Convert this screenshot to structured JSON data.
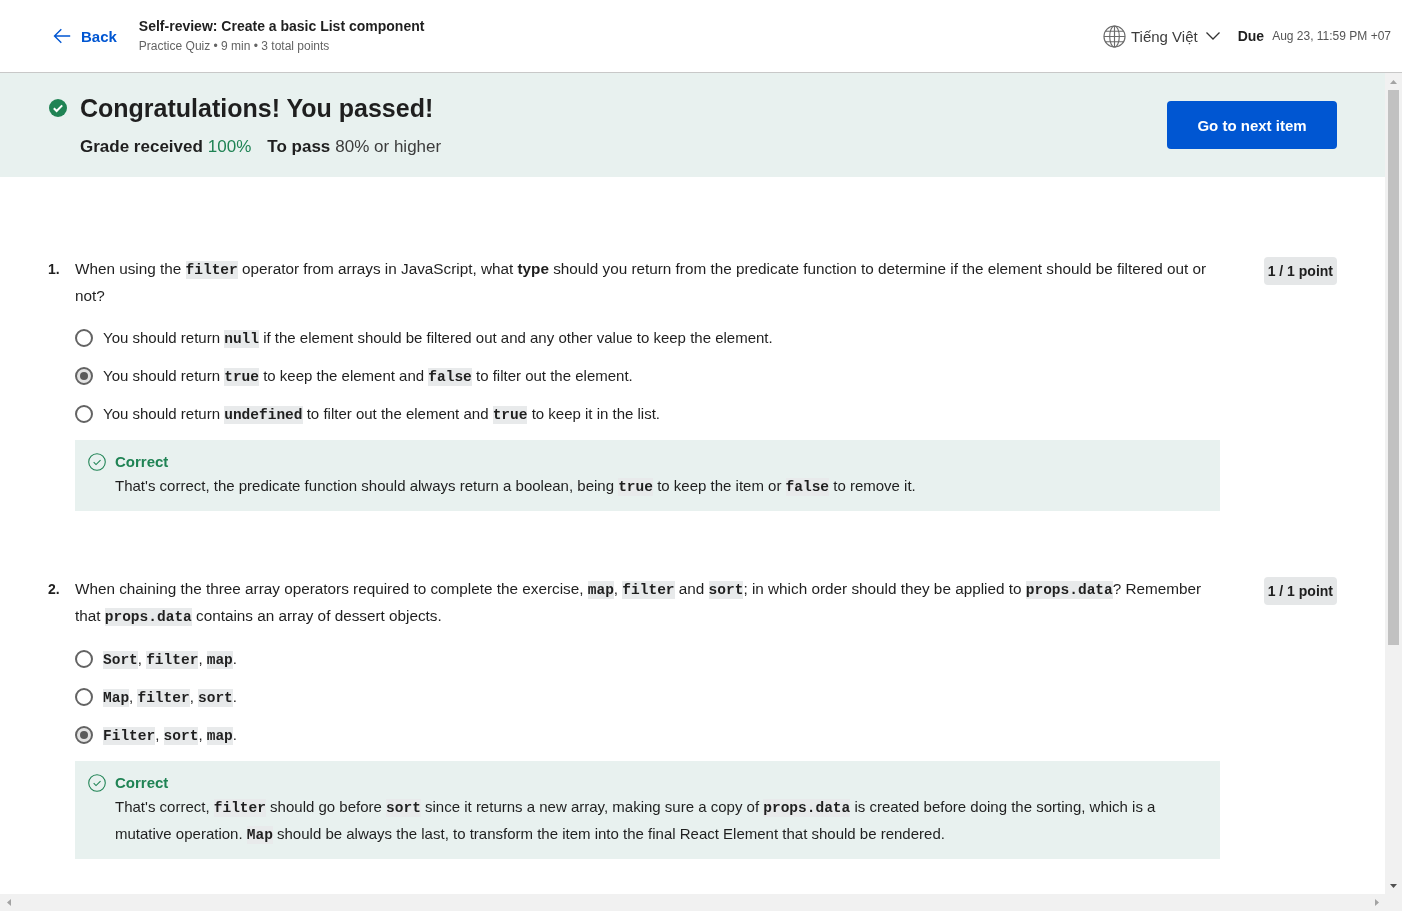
{
  "header": {
    "back_label": "Back",
    "title": "Self-review: Create a basic List component",
    "meta": "Practice Quiz • 9 min • 3 total points",
    "language": "Tiếng Việt",
    "due_label": "Due",
    "due_date": "Aug 23, 11:59 PM +07"
  },
  "result": {
    "heading": "Congratulations! You passed!",
    "grade_label": "Grade received",
    "grade_value": "100%",
    "pass_label": "To pass",
    "pass_value": "80% or higher",
    "button": "Go to next item"
  },
  "questions": [
    {
      "number": "1.",
      "score": "1 / 1 point",
      "prompt": [
        {
          "kind": "text",
          "text": "When using the "
        },
        {
          "kind": "code",
          "text": "filter"
        },
        {
          "kind": "text",
          "text": " operator from arrays in JavaScript, what **type** should you return from the predicate function to determine if the element should be filtered out or not?"
        }
      ],
      "options": [
        {
          "selected": false,
          "text": [
            {
              "kind": "text",
              "text": "You should return "
            },
            {
              "kind": "code",
              "text": "null"
            },
            {
              "kind": "text",
              "text": " if the element should be filtered out and any other value to keep the element."
            }
          ]
        },
        {
          "selected": true,
          "text": [
            {
              "kind": "text",
              "text": "You should return "
            },
            {
              "kind": "code",
              "text": "true"
            },
            {
              "kind": "text",
              "text": " to keep the element and "
            },
            {
              "kind": "code",
              "text": "false"
            },
            {
              "kind": "text",
              "text": " to filter out the element."
            }
          ]
        },
        {
          "selected": false,
          "text": [
            {
              "kind": "text",
              "text": "You should return "
            },
            {
              "kind": "code",
              "text": "undefined"
            },
            {
              "kind": "text",
              "text": " to filter out the element and "
            },
            {
              "kind": "code",
              "text": "true"
            },
            {
              "kind": "text",
              "text": " to keep it in the list."
            }
          ]
        }
      ],
      "feedback": {
        "status": "Correct",
        "correct": true,
        "text": [
          {
            "kind": "text",
            "text": "That's correct, the predicate function should always return a boolean, being "
          },
          {
            "kind": "code",
            "text": "true"
          },
          {
            "kind": "text",
            "text": " to keep the item or "
          },
          {
            "kind": "code",
            "text": "false"
          },
          {
            "kind": "text",
            "text": " to remove it."
          }
        ]
      }
    },
    {
      "number": "2.",
      "score": "1 / 1 point",
      "prompt": [
        {
          "kind": "text",
          "text": "When chaining the three array operators required to complete the exercise, "
        },
        {
          "kind": "code",
          "text": "map"
        },
        {
          "kind": "text",
          "text": ", "
        },
        {
          "kind": "code",
          "text": "filter"
        },
        {
          "kind": "text",
          "text": " and "
        },
        {
          "kind": "code",
          "text": "sort"
        },
        {
          "kind": "text",
          "text": "; in which order should they be applied to "
        },
        {
          "kind": "code",
          "text": "props.data"
        },
        {
          "kind": "text",
          "text": "? Remember that "
        },
        {
          "kind": "code",
          "text": "props.data"
        },
        {
          "kind": "text",
          "text": " contains an array of dessert objects."
        }
      ],
      "options": [
        {
          "selected": false,
          "text": [
            {
              "kind": "code",
              "text": "Sort"
            },
            {
              "kind": "text",
              "text": ", "
            },
            {
              "kind": "code",
              "text": "filter"
            },
            {
              "kind": "text",
              "text": ", "
            },
            {
              "kind": "code",
              "text": "map"
            },
            {
              "kind": "text",
              "text": "."
            }
          ]
        },
        {
          "selected": false,
          "text": [
            {
              "kind": "code",
              "text": "Map"
            },
            {
              "kind": "text",
              "text": ", "
            },
            {
              "kind": "code",
              "text": "filter"
            },
            {
              "kind": "text",
              "text": ", "
            },
            {
              "kind": "code",
              "text": "sort"
            },
            {
              "kind": "text",
              "text": "."
            }
          ]
        },
        {
          "selected": true,
          "text": [
            {
              "kind": "code",
              "text": "Filter"
            },
            {
              "kind": "text",
              "text": ", "
            },
            {
              "kind": "code",
              "text": "sort"
            },
            {
              "kind": "text",
              "text": ", "
            },
            {
              "kind": "code",
              "text": "map"
            },
            {
              "kind": "text",
              "text": "."
            }
          ]
        }
      ],
      "feedback": {
        "status": "Correct",
        "correct": true,
        "text": [
          {
            "kind": "text",
            "text": "That's correct, "
          },
          {
            "kind": "code",
            "text": "filter"
          },
          {
            "kind": "text",
            "text": " should go before "
          },
          {
            "kind": "code",
            "text": "sort"
          },
          {
            "kind": "text",
            "text": " since it returns a new array, making sure a copy of "
          },
          {
            "kind": "code",
            "text": "props.data"
          },
          {
            "kind": "text",
            "text": " is created before doing the sorting, which is a mutative operation. "
          },
          {
            "kind": "code",
            "text": "Map"
          },
          {
            "kind": "text",
            "text": " should be always the last, to transform the item into the final React Element that should be rendered."
          }
        ]
      }
    }
  ]
}
